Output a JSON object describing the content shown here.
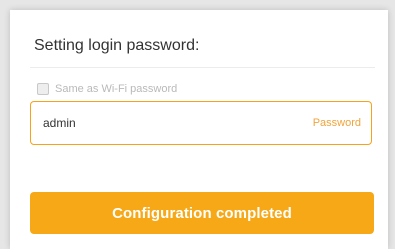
{
  "dialog": {
    "title": "Setting login password:",
    "same_as_wifi": {
      "label": "Same as Wi-Fi password",
      "checked": false
    },
    "password_field": {
      "value": "admin",
      "hint": "Password"
    },
    "submit_label": "Configuration completed"
  },
  "colors": {
    "accent": "#f6a817",
    "field_border": "#f7a21b",
    "hint_text": "#f0a43c"
  }
}
